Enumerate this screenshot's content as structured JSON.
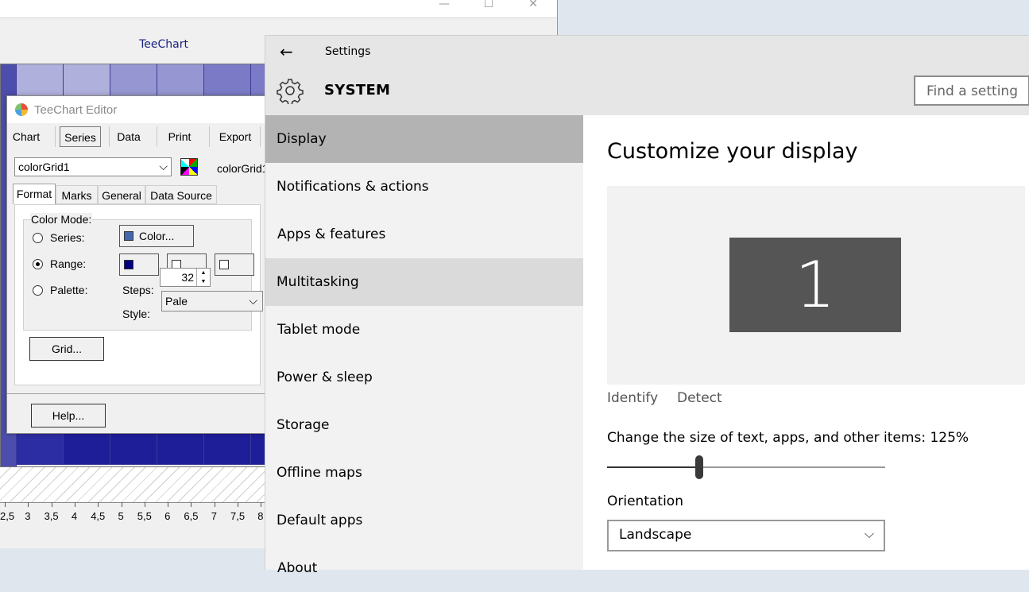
{
  "teechart": {
    "title": "TeeChart",
    "x_ticks": [
      "2,5",
      "3",
      "3,5",
      "4",
      "4,5",
      "5",
      "5,5",
      "6",
      "6,5",
      "7",
      "7,5",
      "8"
    ],
    "window_buttons": {
      "minimize": "—",
      "maximize": "☐",
      "close": "✕"
    }
  },
  "editor": {
    "title": "TeeChart Editor",
    "tabs": [
      "Chart",
      "Series",
      "Data",
      "Print",
      "Export"
    ],
    "selected_tab": "Series",
    "series_combo": "colorGrid1",
    "series_name": "colorGrid1",
    "sub_tabs": [
      "Format",
      "Marks",
      "General",
      "Data Source"
    ],
    "color_mode_label": "Color Mode:",
    "options": [
      "Series:",
      "Range:",
      "Palette:"
    ],
    "selected_option": "Range:",
    "color_button": "Color...",
    "steps_label": "Steps:",
    "steps_value": "32",
    "style_label": "Style:",
    "style_value": "Pale",
    "grid_button": "Grid...",
    "help_button": "Help...",
    "colors": {
      "series_swatch": "#4466aa",
      "range_start": "#000080",
      "range_mid": "#ffffff",
      "range_end": "#ffffff"
    }
  },
  "settings": {
    "window_title": "Settings",
    "section_title": "SYSTEM",
    "search_placeholder": "Find a setting",
    "nav_items": [
      "Display",
      "Notifications & actions",
      "Apps & features",
      "Multitasking",
      "Tablet mode",
      "Power & sleep",
      "Storage",
      "Offline maps",
      "Default apps",
      "About"
    ],
    "active_item": "Display",
    "hover_item": "Multitasking",
    "content": {
      "title": "Customize your display",
      "monitor_number": "1",
      "identify_link": "Identify",
      "detect_link": "Detect",
      "scale_label": "Change the size of text, apps, and other items: 125%",
      "scale_fraction": 0.33,
      "orientation_label": "Orientation",
      "orientation_value": "Landscape"
    },
    "icons": {
      "back": "back-arrow-icon",
      "gear": "gear-icon"
    }
  }
}
